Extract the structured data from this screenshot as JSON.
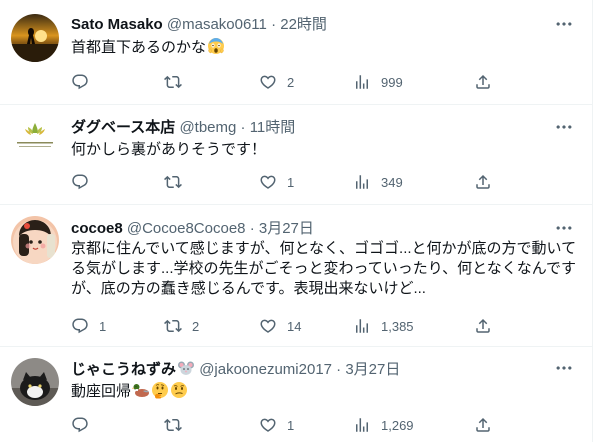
{
  "tweets": [
    {
      "name": "Sato Masako",
      "handle": "@masako0611",
      "sep": "·",
      "time": "22時間",
      "text": "首都直下あるのかな",
      "emoji": [
        "scream-emoji"
      ],
      "reply_count": "",
      "retweet_count": "",
      "like_count": "2",
      "view_count": "999"
    },
    {
      "name": "ダグベース本店",
      "handle": "@tbemg",
      "sep": "·",
      "time": "11時間",
      "text": "何かしら裏がありそうです！",
      "emoji": [],
      "reply_count": "",
      "retweet_count": "",
      "like_count": "1",
      "view_count": "349"
    },
    {
      "name": "cocoe8",
      "handle": "@Cocoe8Cocoe8",
      "sep": "·",
      "time": "3月27日",
      "text_lines": [
        "京都に住んでいて感じますが、何となく、ゴゴゴ...と何かが底の方で動いて",
        "る気がします...学校の先生がごそっと変わっていったり、何となくなんです",
        "が、底の方の蠢き感じるんです。表現出来ないけど..."
      ],
      "emoji": [],
      "reply_count": "1",
      "retweet_count": "2",
      "like_count": "14",
      "view_count": "1,385"
    },
    {
      "name": "じゃこうねずみ",
      "handle": "@jakoonezumi2017",
      "sep": "·",
      "time": "3月27日",
      "text": "動座回帰",
      "emoji": [
        "duck-emoji",
        "thinking-emoji",
        "confused-emoji"
      ],
      "name_emoji": "mouse-emoji",
      "reply_count": "",
      "retweet_count": "",
      "like_count": "1",
      "view_count": "1,269"
    }
  ],
  "colors": {
    "text": "#0f1419",
    "secondary": "#536471",
    "border": "#eff3f4"
  }
}
